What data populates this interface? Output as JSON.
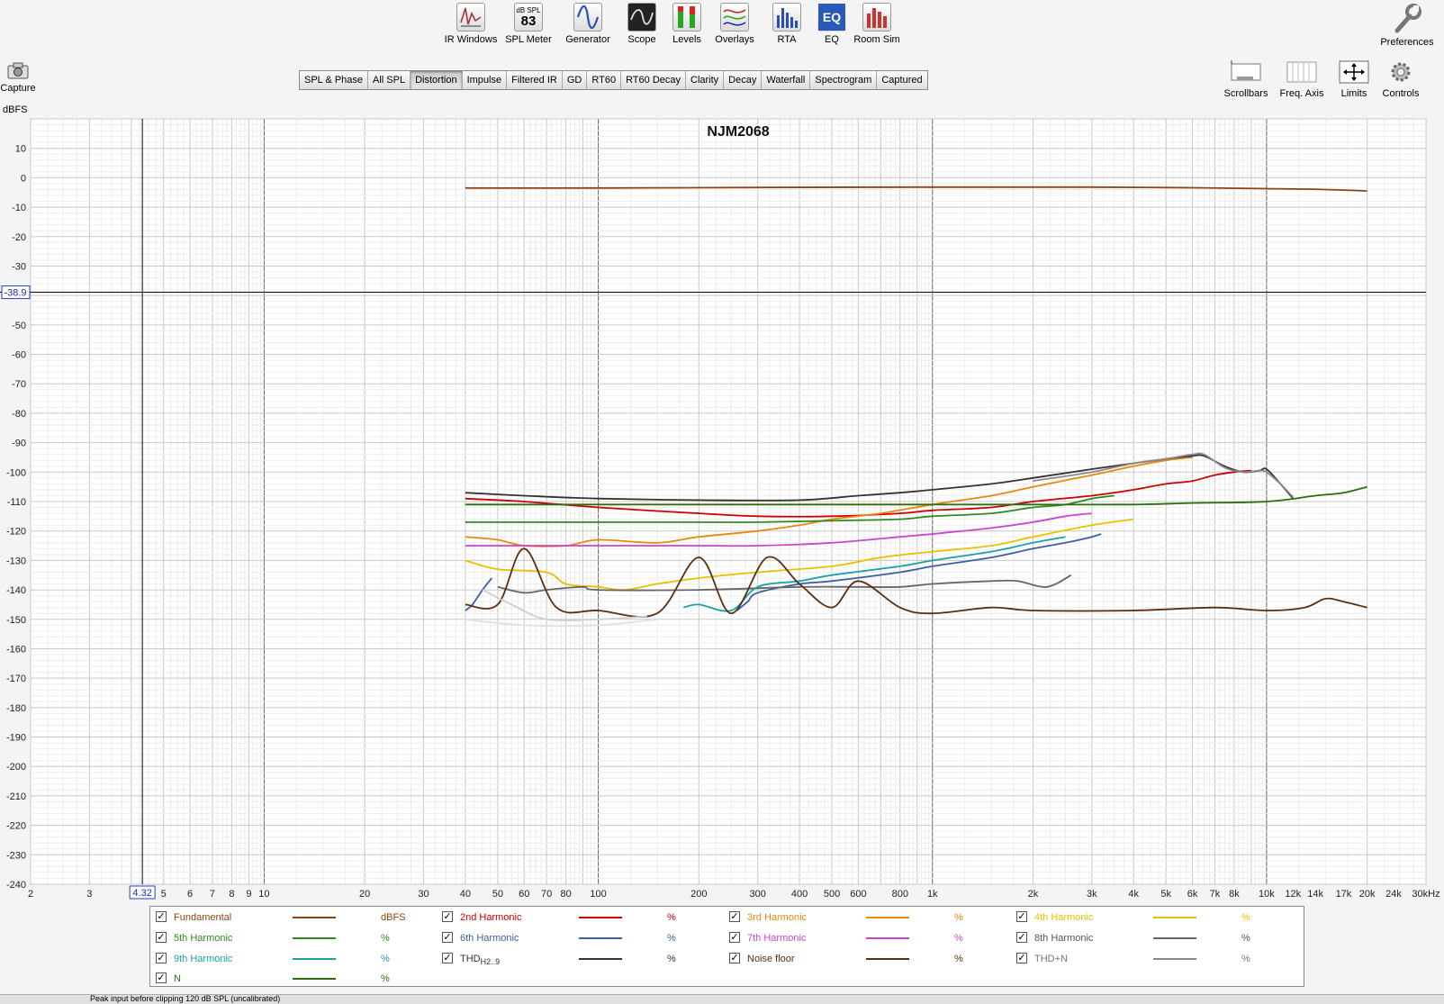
{
  "toolbar": {
    "items": [
      {
        "label": "IR Windows",
        "icon": "ir-windows-icon"
      },
      {
        "label": "SPL Meter",
        "icon": "spl-meter-icon",
        "badge_unit": "dB SPL",
        "badge_value": "83"
      },
      {
        "label": "Generator",
        "icon": "generator-icon"
      },
      {
        "label": "Scope",
        "icon": "scope-icon"
      },
      {
        "label": "Levels",
        "icon": "levels-icon"
      },
      {
        "label": "Overlays",
        "icon": "overlays-icon"
      },
      {
        "label": "RTA",
        "icon": "rta-icon"
      },
      {
        "label": "EQ",
        "icon": "eq-icon",
        "icon_text": "EQ"
      },
      {
        "label": "Room Sim",
        "icon": "room-sim-icon"
      }
    ],
    "preferences": "Preferences",
    "capture": "Capture"
  },
  "tabs": [
    {
      "label": "SPL & Phase"
    },
    {
      "label": "All SPL"
    },
    {
      "label": "Distortion",
      "active": true
    },
    {
      "label": "Impulse"
    },
    {
      "label": "Filtered IR"
    },
    {
      "label": "GD"
    },
    {
      "label": "RT60"
    },
    {
      "label": "RT60 Decay"
    },
    {
      "label": "Clarity"
    },
    {
      "label": "Decay"
    },
    {
      "label": "Waterfall"
    },
    {
      "label": "Spectrogram"
    },
    {
      "label": "Captured"
    }
  ],
  "right_tools": [
    {
      "label": "Scrollbars",
      "icon": "scrollbars-icon"
    },
    {
      "label": "Freq. Axis",
      "icon": "freq-axis-icon"
    },
    {
      "label": "Limits",
      "icon": "limits-icon"
    },
    {
      "label": "Controls",
      "icon": "gear-icon"
    }
  ],
  "status": {
    "text": "Peak input before clipping 120 dB SPL (uncalibrated)"
  },
  "colors": {
    "fundamental": "#8b4513",
    "h2": "#cc0000",
    "h3": "#e8890c",
    "h4": "#e6c200",
    "h5": "#2e8b22",
    "h6": "#3a5fa8",
    "h7": "#cc44cc",
    "h8": "#666666",
    "h9": "#1aa0a8",
    "thd": "#333333",
    "noise": "#5c2e0e",
    "thdn": "#8a8a8a",
    "n": "#2a6e10"
  },
  "chart_data": {
    "type": "line",
    "title": "NJM2068",
    "ylabel": "dBFS",
    "xscale": "log",
    "xlim": [
      2,
      30000
    ],
    "ylim": [
      -240,
      20
    ],
    "grid": true,
    "cursor": {
      "x_readout": "4.32",
      "y_readout": "-38.9",
      "x": 4.32,
      "y": -38.9
    },
    "x_ticks": [
      {
        "v": 2,
        "label": "2"
      },
      {
        "v": 3,
        "label": "3"
      },
      {
        "v": 4.32,
        "label": ""
      },
      {
        "v": 5,
        "label": "5"
      },
      {
        "v": 6,
        "label": "6"
      },
      {
        "v": 7,
        "label": "7"
      },
      {
        "v": 8,
        "label": "8"
      },
      {
        "v": 9,
        "label": "9"
      },
      {
        "v": 10,
        "label": "10"
      },
      {
        "v": 20,
        "label": "20"
      },
      {
        "v": 30,
        "label": "30"
      },
      {
        "v": 40,
        "label": "40"
      },
      {
        "v": 50,
        "label": "50"
      },
      {
        "v": 60,
        "label": "60"
      },
      {
        "v": 70,
        "label": "70"
      },
      {
        "v": 80,
        "label": "80"
      },
      {
        "v": 100,
        "label": "100"
      },
      {
        "v": 200,
        "label": "200"
      },
      {
        "v": 300,
        "label": "300"
      },
      {
        "v": 400,
        "label": "400"
      },
      {
        "v": 500,
        "label": "500"
      },
      {
        "v": 600,
        "label": "600"
      },
      {
        "v": 800,
        "label": "800"
      },
      {
        "v": 1000,
        "label": "1k"
      },
      {
        "v": 2000,
        "label": "2k"
      },
      {
        "v": 3000,
        "label": "3k"
      },
      {
        "v": 4000,
        "label": "4k"
      },
      {
        "v": 5000,
        "label": "5k"
      },
      {
        "v": 6000,
        "label": "6k"
      },
      {
        "v": 7000,
        "label": "7k"
      },
      {
        "v": 8000,
        "label": "8k"
      },
      {
        "v": 10000,
        "label": "10k"
      },
      {
        "v": 12000,
        "label": "12k"
      },
      {
        "v": 14000,
        "label": "14k"
      },
      {
        "v": 17000,
        "label": "17k"
      },
      {
        "v": 20000,
        "label": "20k"
      },
      {
        "v": 24000,
        "label": "24k"
      },
      {
        "v": 30000,
        "label": "30kHz"
      }
    ],
    "y_ticks": [
      10,
      0,
      -10,
      -20,
      -30,
      -40,
      -50,
      -60,
      -70,
      -80,
      -90,
      -100,
      -110,
      -120,
      -130,
      -140,
      -150,
      -160,
      -170,
      -180,
      -190,
      -200,
      -210,
      -220,
      -230,
      -240
    ],
    "series": [
      {
        "name": "Fundamental",
        "unit": "dBFS",
        "color": "#8b4513",
        "legend": true,
        "points": [
          [
            40,
            -3.5
          ],
          [
            100,
            -3.5
          ],
          [
            300,
            -3.3
          ],
          [
            1000,
            -3.2
          ],
          [
            3000,
            -3.2
          ],
          [
            6000,
            -3.4
          ],
          [
            10000,
            -3.7
          ],
          [
            15000,
            -4
          ],
          [
            20000,
            -4.5
          ]
        ]
      },
      {
        "name": "2nd Harmonic",
        "unit": "%",
        "color": "#cc0000",
        "legend": true,
        "points": [
          [
            40,
            -109
          ],
          [
            60,
            -110
          ],
          [
            100,
            -112
          ],
          [
            200,
            -114
          ],
          [
            300,
            -115
          ],
          [
            500,
            -115
          ],
          [
            800,
            -114
          ],
          [
            1000,
            -113
          ],
          [
            1500,
            -112
          ],
          [
            2000,
            -110
          ],
          [
            3000,
            -108
          ],
          [
            4000,
            -106
          ],
          [
            5000,
            -104
          ],
          [
            6000,
            -103
          ],
          [
            7000,
            -101
          ],
          [
            8000,
            -100
          ],
          [
            9000,
            -99.5
          ]
        ]
      },
      {
        "name": "3rd Harmonic",
        "unit": "%",
        "color": "#e8890c",
        "legend": true,
        "points": [
          [
            40,
            -122
          ],
          [
            50,
            -123
          ],
          [
            60,
            -125
          ],
          [
            80,
            -125
          ],
          [
            100,
            -123
          ],
          [
            150,
            -124
          ],
          [
            200,
            -122
          ],
          [
            300,
            -120
          ],
          [
            400,
            -118
          ],
          [
            500,
            -116
          ],
          [
            700,
            -114
          ],
          [
            1000,
            -111
          ],
          [
            1500,
            -108
          ],
          [
            2000,
            -105
          ],
          [
            3000,
            -101
          ],
          [
            4000,
            -98
          ],
          [
            5000,
            -96
          ],
          [
            6000,
            -95
          ]
        ]
      },
      {
        "name": "4th Harmonic",
        "unit": "%",
        "color": "#e6c200",
        "legend": true,
        "points": [
          [
            40,
            -130
          ],
          [
            50,
            -133
          ],
          [
            70,
            -134
          ],
          [
            80,
            -138
          ],
          [
            100,
            -139
          ],
          [
            120,
            -140
          ],
          [
            150,
            -138
          ],
          [
            200,
            -136
          ],
          [
            300,
            -134
          ],
          [
            500,
            -132
          ],
          [
            700,
            -129
          ],
          [
            1000,
            -127
          ],
          [
            1500,
            -125
          ],
          [
            2000,
            -122
          ],
          [
            3000,
            -118
          ],
          [
            4000,
            -116
          ]
        ]
      },
      {
        "name": "5th Harmonic",
        "unit": "%",
        "color": "#2e8b22",
        "legend": true,
        "points": [
          [
            40,
            -117
          ],
          [
            100,
            -117
          ],
          [
            200,
            -117
          ],
          [
            300,
            -117
          ],
          [
            500,
            -116.5
          ],
          [
            800,
            -116
          ],
          [
            1000,
            -115
          ],
          [
            1500,
            -114
          ],
          [
            2000,
            -112
          ],
          [
            2500,
            -111
          ],
          [
            3000,
            -109
          ],
          [
            3500,
            -108
          ]
        ]
      },
      {
        "name": "6th Harmonic",
        "unit": "%",
        "color": "#3a5fa8",
        "legend": true,
        "points": [
          [
            40,
            -147
          ],
          [
            42,
            -145
          ],
          [
            45,
            -140
          ],
          [
            48,
            -136
          ],
          [
            260,
            -147
          ],
          [
            280,
            -144
          ],
          [
            300,
            -141
          ],
          [
            400,
            -138
          ],
          [
            500,
            -137
          ],
          [
            800,
            -134
          ],
          [
            1000,
            -132
          ],
          [
            1500,
            -129
          ],
          [
            2000,
            -126
          ],
          [
            2500,
            -124
          ],
          [
            3000,
            -122
          ],
          [
            3200,
            -121
          ]
        ]
      },
      {
        "name": "7th Harmonic",
        "unit": "%",
        "color": "#cc44cc",
        "legend": true,
        "points": [
          [
            40,
            -125
          ],
          [
            100,
            -125
          ],
          [
            200,
            -125
          ],
          [
            300,
            -125
          ],
          [
            500,
            -124
          ],
          [
            800,
            -122
          ],
          [
            1000,
            -121
          ],
          [
            1500,
            -119
          ],
          [
            2000,
            -117
          ],
          [
            2500,
            -115
          ],
          [
            3000,
            -114
          ]
        ]
      },
      {
        "name": "8th Harmonic",
        "unit": "%",
        "color": "#666666",
        "legend": true,
        "points": [
          [
            50,
            -139
          ],
          [
            60,
            -141
          ],
          [
            70,
            -140
          ],
          [
            90,
            -139
          ],
          [
            100,
            -140
          ],
          [
            200,
            -140
          ],
          [
            400,
            -139
          ],
          [
            600,
            -139
          ],
          [
            800,
            -139
          ],
          [
            1000,
            -138
          ],
          [
            1500,
            -137
          ],
          [
            1800,
            -137
          ],
          [
            2200,
            -139
          ],
          [
            2600,
            -135
          ]
        ]
      },
      {
        "name": "9th Harmonic",
        "unit": "%",
        "color": "#1aa0a8",
        "legend": true,
        "points": [
          [
            180,
            -146
          ],
          [
            200,
            -145
          ],
          [
            250,
            -147
          ],
          [
            300,
            -139
          ],
          [
            400,
            -137
          ],
          [
            500,
            -135
          ],
          [
            800,
            -132
          ],
          [
            1000,
            -130
          ],
          [
            1500,
            -127
          ],
          [
            2000,
            -124
          ],
          [
            2500,
            -122
          ]
        ]
      },
      {
        "name": "THD",
        "name_sub": "H2..9",
        "unit": "%",
        "color": "#333333",
        "legend": true,
        "points": [
          [
            40,
            -107
          ],
          [
            60,
            -108
          ],
          [
            100,
            -109
          ],
          [
            200,
            -109.5
          ],
          [
            400,
            -109.5
          ],
          [
            600,
            -108
          ],
          [
            800,
            -107
          ],
          [
            1000,
            -106
          ],
          [
            1500,
            -104
          ],
          [
            2000,
            -102
          ],
          [
            3000,
            -99
          ],
          [
            4000,
            -97
          ],
          [
            5000,
            -95.5
          ],
          [
            6000,
            -94.5
          ],
          [
            6500,
            -94.5
          ],
          [
            7500,
            -98
          ],
          [
            8500,
            -100
          ],
          [
            9500,
            -99.5
          ],
          [
            10000,
            -99
          ],
          [
            11000,
            -104
          ],
          [
            12000,
            -109
          ]
        ]
      },
      {
        "name": "Noise floor",
        "unit": "%",
        "color": "#5c2e0e",
        "legend": true,
        "points": [
          [
            40,
            -145
          ],
          [
            50,
            -145
          ],
          [
            60,
            -126
          ],
          [
            75,
            -146
          ],
          [
            100,
            -147
          ],
          [
            150,
            -148
          ],
          [
            200,
            -129
          ],
          [
            250,
            -148
          ],
          [
            320,
            -129
          ],
          [
            400,
            -138
          ],
          [
            500,
            -146
          ],
          [
            600,
            -137
          ],
          [
            800,
            -146
          ],
          [
            1000,
            -148
          ],
          [
            1500,
            -146
          ],
          [
            2000,
            -147
          ],
          [
            4000,
            -147
          ],
          [
            7000,
            -146
          ],
          [
            10000,
            -147
          ],
          [
            13000,
            -146
          ],
          [
            15000,
            -143
          ],
          [
            17000,
            -144
          ],
          [
            20000,
            -146
          ]
        ]
      },
      {
        "name": "THD+N",
        "unit": "%",
        "color": "#8a8a8a",
        "legend": true,
        "points": [
          [
            2000,
            -103
          ],
          [
            3000,
            -100
          ],
          [
            4000,
            -97
          ],
          [
            5000,
            -95.5
          ],
          [
            6000,
            -94
          ],
          [
            6500,
            -94
          ],
          [
            7500,
            -98.5
          ],
          [
            8500,
            -100
          ],
          [
            9500,
            -99.5
          ],
          [
            10000,
            -100
          ],
          [
            11000,
            -104
          ],
          [
            12000,
            -108.5
          ]
        ]
      },
      {
        "name": "N",
        "unit": "%",
        "color": "#2a6e10",
        "legend": true,
        "points": [
          [
            40,
            -111
          ],
          [
            100,
            -111
          ],
          [
            300,
            -111
          ],
          [
            1000,
            -111
          ],
          [
            2000,
            -111
          ],
          [
            4000,
            -111
          ],
          [
            6000,
            -110.5
          ],
          [
            10000,
            -110
          ],
          [
            14000,
            -108
          ],
          [
            17000,
            -107
          ],
          [
            20000,
            -105
          ]
        ]
      },
      {
        "name": "",
        "color": "#e0e0e0",
        "legend": false,
        "points": [
          [
            40,
            -150
          ],
          [
            60,
            -152
          ],
          [
            100,
            -152
          ],
          [
            150,
            -150
          ]
        ]
      },
      {
        "name": "",
        "color": "#cfcfcf",
        "legend": false,
        "points": [
          [
            45,
            -140
          ],
          [
            55,
            -145
          ],
          [
            70,
            -150
          ],
          [
            100,
            -150
          ],
          [
            140,
            -149
          ]
        ]
      }
    ]
  }
}
